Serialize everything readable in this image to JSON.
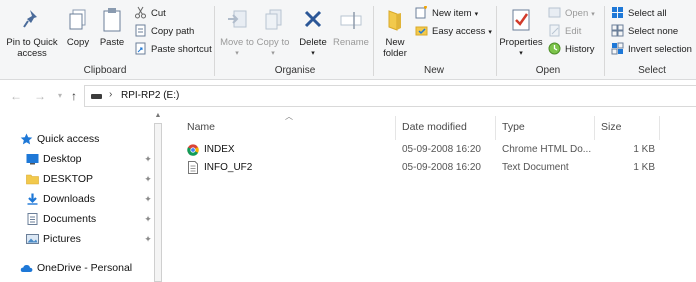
{
  "ribbon": {
    "clipboard": {
      "group_label": "Clipboard",
      "pin": "Pin to Quick access",
      "copy": "Copy",
      "paste": "Paste",
      "cut": "Cut",
      "copy_path": "Copy path",
      "paste_shortcut": "Paste shortcut"
    },
    "organise": {
      "group_label": "Organise",
      "move_to": "Move to",
      "copy_to": "Copy to",
      "delete": "Delete",
      "rename": "Rename"
    },
    "new": {
      "group_label": "New",
      "new_folder": "New folder",
      "new_item": "New item",
      "easy_access": "Easy access"
    },
    "open": {
      "group_label": "Open",
      "properties": "Properties",
      "open": "Open",
      "edit": "Edit",
      "history": "History"
    },
    "select": {
      "group_label": "Select",
      "select_all": "Select all",
      "select_none": "Select none",
      "invert_selection": "Invert selection"
    }
  },
  "address": {
    "path": "RPI-RP2 (E:)"
  },
  "nav": {
    "items": [
      {
        "label": "Quick access",
        "icon": "star-icon",
        "pinned": false
      },
      {
        "label": "Desktop",
        "icon": "desktop-icon",
        "pinned": true
      },
      {
        "label": "DESKTOP",
        "icon": "folder-icon",
        "pinned": true
      },
      {
        "label": "Downloads",
        "icon": "download-icon",
        "pinned": true
      },
      {
        "label": "Documents",
        "icon": "documents-icon",
        "pinned": true
      },
      {
        "label": "Pictures",
        "icon": "pictures-icon",
        "pinned": true
      },
      {
        "label": "OneDrive - Personal",
        "icon": "cloud-icon",
        "pinned": false
      }
    ]
  },
  "files": {
    "columns": {
      "name": "Name",
      "date": "Date modified",
      "type": "Type",
      "size": "Size"
    },
    "rows": [
      {
        "name": "INDEX",
        "date": "05-09-2008 16:20",
        "type": "Chrome HTML Do...",
        "size": "1 KB",
        "icon": "chrome-icon"
      },
      {
        "name": "INFO_UF2",
        "date": "05-09-2008 16:20",
        "type": "Text Document",
        "size": "1 KB",
        "icon": "text-file-icon"
      }
    ]
  },
  "colors": {
    "accent": "#1e78d7",
    "folder": "#f2c94c",
    "delete": "#2b5797"
  }
}
